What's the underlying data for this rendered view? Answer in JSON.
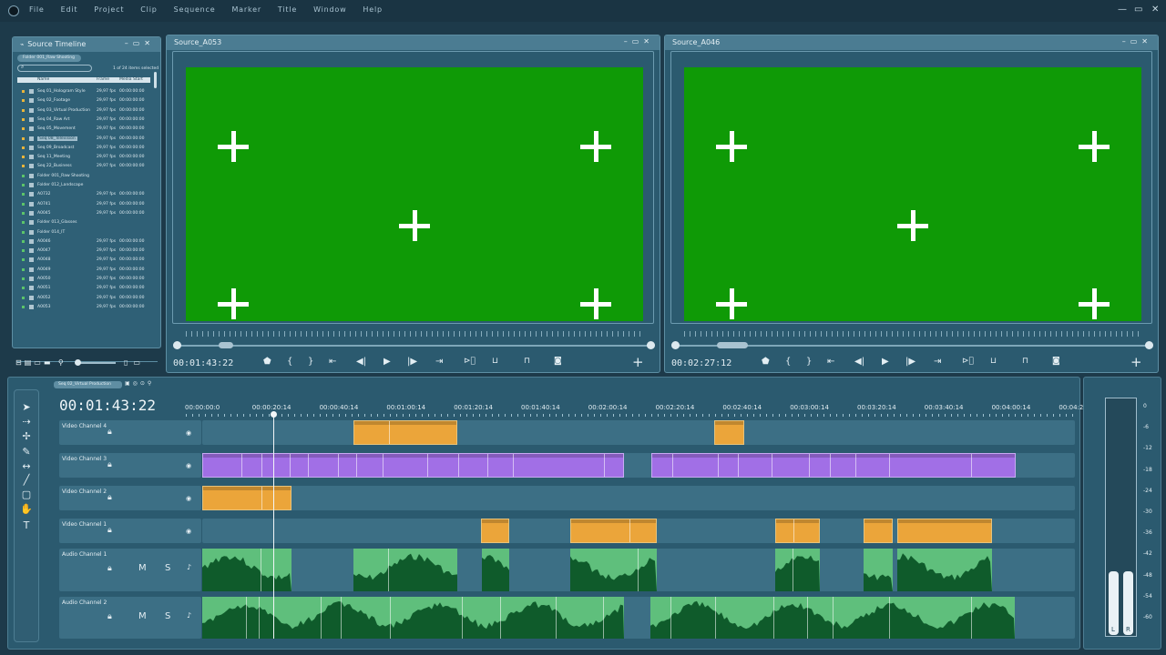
{
  "menubar": {
    "items": [
      "File",
      "Edit",
      "Project",
      "Clip",
      "Sequence",
      "Marker",
      "Title",
      "Window",
      "Help"
    ],
    "window_controls": [
      "—",
      "▭",
      "✕"
    ]
  },
  "source_timeline": {
    "title": "Source Timeline",
    "folder_chip": "Folder 001_Raw Shooting",
    "selection_info": "1 of 24 items selected",
    "columns": [
      "Name",
      "Frame",
      "Media Start"
    ],
    "rows": [
      {
        "name": "Seq 01_Hologram Style",
        "frame": "29,97 fps",
        "start": "00:00:00:00",
        "color": "#e8b43a",
        "icon": "sequence-icon"
      },
      {
        "name": "Seq 02_Footage",
        "frame": "29,97 fps",
        "start": "00:00:00:00",
        "color": "#e8b43a",
        "icon": "sequence-icon"
      },
      {
        "name": "Seq 03_Virtual Production",
        "frame": "29,97 fps",
        "start": "00:00:00:00",
        "color": "#e8b43a",
        "icon": "sequence-icon"
      },
      {
        "name": "Seq 04_Raw Art",
        "frame": "29,97 fps",
        "start": "00:00:00:00",
        "color": "#e8b43a",
        "icon": "sequence-icon"
      },
      {
        "name": "Seq 05_Movement",
        "frame": "29,97 fps",
        "start": "00:00:00:00",
        "color": "#e8b43a",
        "icon": "sequence-icon"
      },
      {
        "name": "Seq 08_Television",
        "frame": "29,97 fps",
        "start": "00:00:00:00",
        "color": "#e8b43a",
        "icon": "sequence-icon",
        "selected": true
      },
      {
        "name": "Seq 09_Broadcast",
        "frame": "29,97 fps",
        "start": "00:00:00:00",
        "color": "#e8b43a",
        "icon": "sequence-icon"
      },
      {
        "name": "Seq 11_Meeting",
        "frame": "29,97 fps",
        "start": "00:00:00:00",
        "color": "#e8b43a",
        "icon": "sequence-icon"
      },
      {
        "name": "Seq 22_Business",
        "frame": "29,97 fps",
        "start": "00:00:00:00",
        "color": "#e8b43a",
        "icon": "sequence-icon"
      },
      {
        "name": "Folder 001_Raw Shooting",
        "frame": "",
        "start": "",
        "color": "#5cc46a",
        "icon": "folder-icon"
      },
      {
        "name": "Folder 012_Landscape",
        "frame": "",
        "start": "",
        "color": "#5cc46a",
        "icon": "folder-icon"
      },
      {
        "name": "A0732",
        "frame": "29,97 fps",
        "start": "00:00:00:00",
        "color": "#5cc46a",
        "icon": "clip-icon"
      },
      {
        "name": "A0741",
        "frame": "29,97 fps",
        "start": "00:00:00:00",
        "color": "#5cc46a",
        "icon": "clip-icon"
      },
      {
        "name": "A0045",
        "frame": "29,97 fps",
        "start": "00:00:00:00",
        "color": "#5cc46a",
        "icon": "clip-icon"
      },
      {
        "name": "Folder 013_Glasses",
        "frame": "",
        "start": "",
        "color": "#5cc46a",
        "icon": "folder-icon"
      },
      {
        "name": "Folder 014_IT",
        "frame": "",
        "start": "",
        "color": "#5cc46a",
        "icon": "folder-icon"
      },
      {
        "name": "A0046",
        "frame": "29,97 fps",
        "start": "00:00:00:00",
        "color": "#5cc46a",
        "icon": "clip-icon"
      },
      {
        "name": "A0047",
        "frame": "29,97 fps",
        "start": "00:00:00:00",
        "color": "#5cc46a",
        "icon": "clip-icon"
      },
      {
        "name": "A0048",
        "frame": "29,97 fps",
        "start": "00:00:00:00",
        "color": "#5cc46a",
        "icon": "clip-icon"
      },
      {
        "name": "A0049",
        "frame": "29,97 fps",
        "start": "00:00:00:00",
        "color": "#5cc46a",
        "icon": "clip-icon"
      },
      {
        "name": "A0050",
        "frame": "29,97 fps",
        "start": "00:00:00:00",
        "color": "#5cc46a",
        "icon": "clip-icon"
      },
      {
        "name": "A0051",
        "frame": "29,97 fps",
        "start": "00:00:00:00",
        "color": "#5cc46a",
        "icon": "clip-icon"
      },
      {
        "name": "A0052",
        "frame": "29,97 fps",
        "start": "00:00:00:00",
        "color": "#5cc46a",
        "icon": "clip-icon"
      },
      {
        "name": "A0053",
        "frame": "29,97 fps",
        "start": "00:00:00:00",
        "color": "#5cc46a",
        "icon": "clip-icon"
      }
    ]
  },
  "viewer_left": {
    "title": "Source_A053",
    "timecode": "00:01:43:22"
  },
  "viewer_right": {
    "title": "Source_A046",
    "timecode": "00:02:27:12"
  },
  "viewer_controls": {
    "marker": "⬟",
    "in": "{",
    "out": "}",
    "go_in": "⇤",
    "step_back": "◀|",
    "play": "▶",
    "step_fwd": "|▶",
    "go_out": "⇥",
    "add": "+"
  },
  "timeline": {
    "sequence_tab": "Seq 02_Virtual Production",
    "timecode": "00:01:43:22",
    "ruler": [
      "00:00:00:0",
      "00:00:20:14",
      "00:00:40:14",
      "00:01:00:14",
      "00:01:20:14",
      "00:01:40:14",
      "00:02:00:14",
      "00:02:20:14",
      "00:02:40:14",
      "00:03:00:14",
      "00:03:20:14",
      "00:03:40:14",
      "00:04:00:14",
      "00:04:2"
    ],
    "tracks": {
      "v4": "Video Channel 4",
      "v3": "Video Channel 3",
      "v2": "Video Channel 2",
      "v1": "Video Channel 1",
      "a1": "Audio Channel 1",
      "a2": "Audio Channel 2"
    },
    "mute": "M",
    "solo": "S"
  },
  "meter": {
    "scale": [
      "0",
      "-6",
      "-12",
      "-18",
      "-24",
      "-30",
      "-36",
      "-42",
      "-48",
      "-54",
      "-60"
    ],
    "left": "L",
    "right": "R",
    "level_left": 0.11,
    "level_right": 0.11
  },
  "colors": {
    "chroma_green": "#0f9a06",
    "clip_orange": "#eba53a",
    "clip_purple": "#a16fe6",
    "audio_green": "#5fbf7c"
  }
}
